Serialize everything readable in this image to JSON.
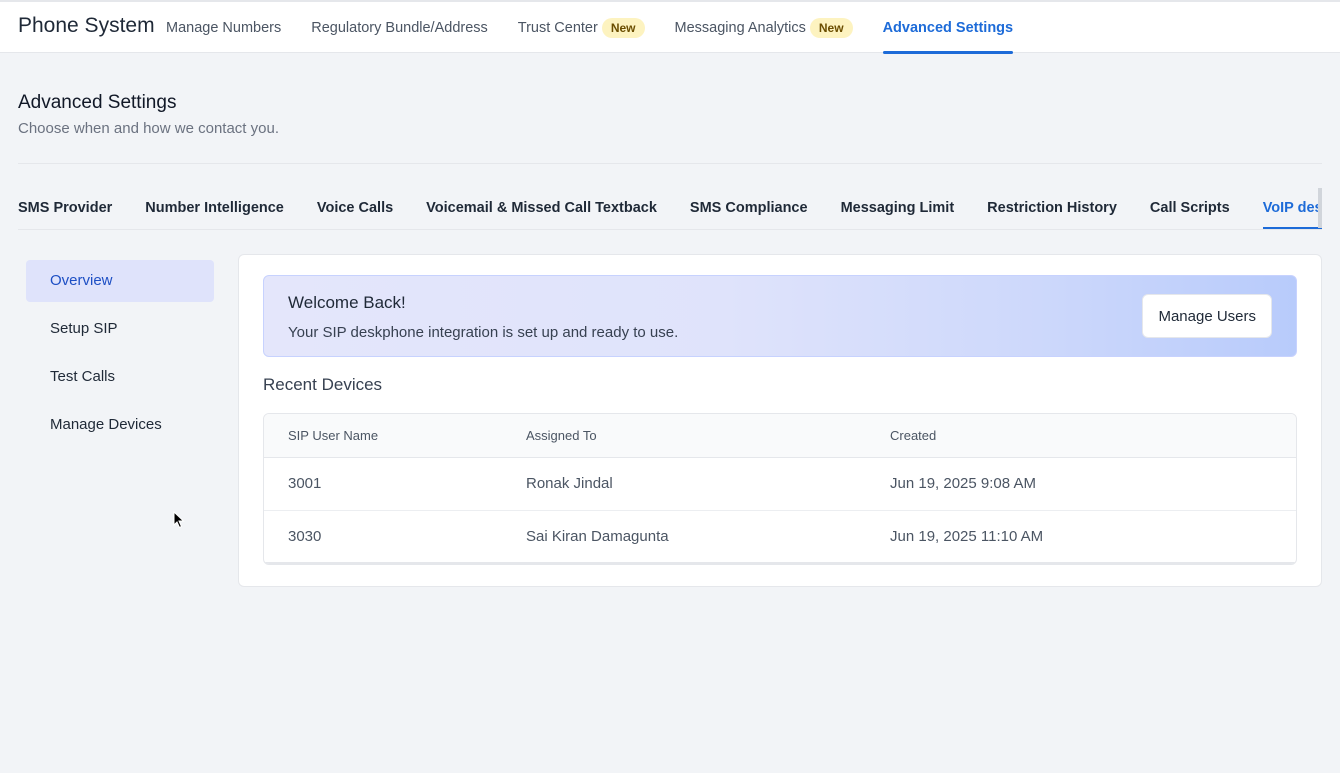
{
  "brand": "Phone System",
  "top_nav": [
    {
      "label": "Manage Numbers",
      "badge": null,
      "active": false
    },
    {
      "label": "Regulatory Bundle/Address",
      "badge": null,
      "active": false
    },
    {
      "label": "Trust Center",
      "badge": "New",
      "active": false
    },
    {
      "label": "Messaging Analytics",
      "badge": "New",
      "active": false
    },
    {
      "label": "Advanced Settings",
      "badge": null,
      "active": true
    }
  ],
  "header": {
    "title": "Advanced Settings",
    "subtitle": "Choose when and how we contact you."
  },
  "sub_tabs": [
    "SMS Provider",
    "Number Intelligence",
    "Voice Calls",
    "Voicemail & Missed Call Textback",
    "SMS Compliance",
    "Messaging Limit",
    "Restriction History",
    "Call Scripts",
    "VoIP deskphone (SIP)"
  ],
  "active_sub_tab": "VoIP deskphone (SIP)",
  "sidebar": {
    "items": [
      {
        "label": "Overview",
        "active": true
      },
      {
        "label": "Setup SIP",
        "active": false
      },
      {
        "label": "Test Calls",
        "active": false
      },
      {
        "label": "Manage Devices",
        "active": false
      }
    ]
  },
  "banner": {
    "title": "Welcome Back!",
    "text": "Your SIP deskphone integration is set up and ready to use.",
    "button_label": "Manage Users"
  },
  "recent_devices": {
    "title": "Recent Devices",
    "columns": [
      "SIP User Name",
      "Assigned To",
      "Created"
    ],
    "rows": [
      [
        "3001",
        "Ronak Jindal",
        "Jun 19, 2025 9:08 AM"
      ],
      [
        "3030",
        "Sai Kiran Damagunta",
        "Jun 19, 2025 11:10 AM"
      ]
    ]
  },
  "colors": {
    "accent": "#1d6bd8",
    "badge_bg": "#fdf3c0",
    "sidebar_active_bg": "#dfe3fb"
  }
}
